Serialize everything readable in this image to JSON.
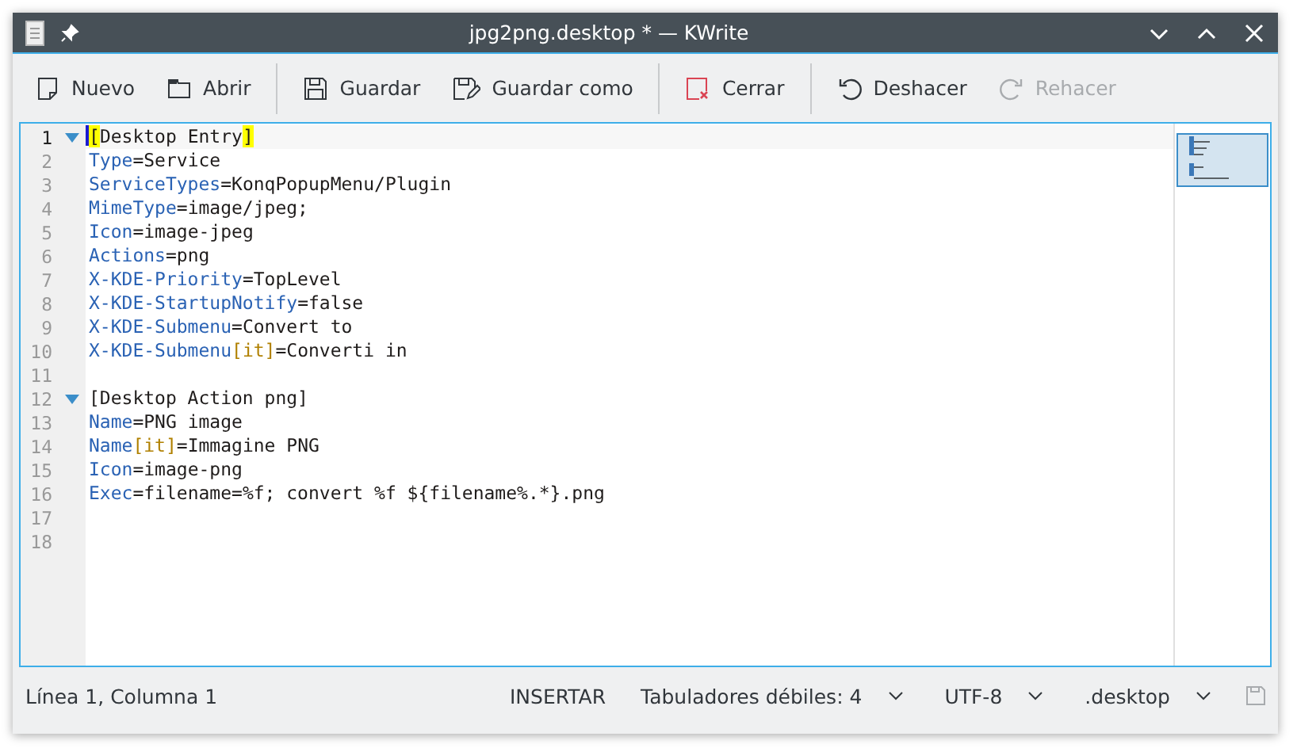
{
  "window": {
    "title": "jpg2png.desktop * — KWrite"
  },
  "toolbar": [
    [
      {
        "label": "Nuevo",
        "kind": "new",
        "disabled": false
      },
      {
        "label": "Abrir",
        "kind": "open",
        "disabled": false
      }
    ],
    [
      {
        "label": "Guardar",
        "kind": "save",
        "disabled": false
      },
      {
        "label": "Guardar como",
        "kind": "saveas",
        "disabled": false
      }
    ],
    [
      {
        "label": "Cerrar",
        "kind": "close",
        "disabled": false
      }
    ],
    [
      {
        "label": "Deshacer",
        "kind": "undo",
        "disabled": false
      },
      {
        "label": "Rehacer",
        "kind": "redo",
        "disabled": true
      }
    ]
  ],
  "editor": {
    "lines": [
      {
        "number": "1",
        "fold": true,
        "current": true,
        "segments": [
          {
            "t": "[",
            "kind": "match"
          },
          {
            "t": "Desktop Entry",
            "kind": "plain"
          },
          {
            "t": "]",
            "kind": "match"
          }
        ]
      },
      {
        "number": "2",
        "fold": false,
        "current": false,
        "segments": [
          {
            "t": "Type",
            "kind": "key"
          },
          {
            "t": "=Service",
            "kind": "plain"
          }
        ]
      },
      {
        "number": "3",
        "fold": false,
        "current": false,
        "segments": [
          {
            "t": "ServiceTypes",
            "kind": "key"
          },
          {
            "t": "=KonqPopupMenu/Plugin",
            "kind": "plain"
          }
        ]
      },
      {
        "number": "4",
        "fold": false,
        "current": false,
        "segments": [
          {
            "t": "MimeType",
            "kind": "key"
          },
          {
            "t": "=image/jpeg;",
            "kind": "plain"
          }
        ]
      },
      {
        "number": "5",
        "fold": false,
        "current": false,
        "segments": [
          {
            "t": "Icon",
            "kind": "key"
          },
          {
            "t": "=image-jpeg",
            "kind": "plain"
          }
        ]
      },
      {
        "number": "6",
        "fold": false,
        "current": false,
        "segments": [
          {
            "t": "Actions",
            "kind": "key"
          },
          {
            "t": "=png",
            "kind": "plain"
          }
        ]
      },
      {
        "number": "7",
        "fold": false,
        "current": false,
        "segments": [
          {
            "t": "X-KDE-Priority",
            "kind": "key"
          },
          {
            "t": "=TopLevel",
            "kind": "plain"
          }
        ]
      },
      {
        "number": "8",
        "fold": false,
        "current": false,
        "segments": [
          {
            "t": "X-KDE-StartupNotify",
            "kind": "key"
          },
          {
            "t": "=false",
            "kind": "plain"
          }
        ]
      },
      {
        "number": "9",
        "fold": false,
        "current": false,
        "segments": [
          {
            "t": "X-KDE-Submenu",
            "kind": "key"
          },
          {
            "t": "=Convert to",
            "kind": "plain"
          }
        ]
      },
      {
        "number": "10",
        "fold": false,
        "current": false,
        "segments": [
          {
            "t": "X-KDE-Submenu",
            "kind": "key"
          },
          {
            "t": "[it]",
            "kind": "locale"
          },
          {
            "t": "=Converti in",
            "kind": "plain"
          }
        ]
      },
      {
        "number": "11",
        "fold": false,
        "current": false
      },
      {
        "number": "12",
        "fold": true,
        "current": false,
        "segments": [
          {
            "t": "[Desktop Action png]",
            "kind": "plain"
          }
        ]
      },
      {
        "number": "13",
        "fold": false,
        "current": false,
        "segments": [
          {
            "t": "Name",
            "kind": "key"
          },
          {
            "t": "=PNG image",
            "kind": "plain"
          }
        ]
      },
      {
        "number": "14",
        "fold": false,
        "current": false,
        "segments": [
          {
            "t": "Name",
            "kind": "key"
          },
          {
            "t": "[it]",
            "kind": "locale"
          },
          {
            "t": "=Immagine PNG",
            "kind": "plain"
          }
        ]
      },
      {
        "number": "15",
        "fold": false,
        "current": false,
        "segments": [
          {
            "t": "Icon",
            "kind": "key"
          },
          {
            "t": "=image-png",
            "kind": "plain"
          }
        ]
      },
      {
        "number": "16",
        "fold": false,
        "current": false,
        "segments": [
          {
            "t": "Exec",
            "kind": "key"
          },
          {
            "t": "=filename=%f; convert %f ${filename%.*}.png",
            "kind": "plain"
          }
        ]
      },
      {
        "number": "17",
        "fold": false,
        "current": false
      },
      {
        "number": "18",
        "fold": false,
        "current": false
      }
    ]
  },
  "status_bar": {
    "position": "Línea 1, Columna 1",
    "mode": "INSERTAR",
    "indent": "Tabuladores débiles: 4",
    "encoding": "UTF-8",
    "filetype": ".desktop"
  }
}
